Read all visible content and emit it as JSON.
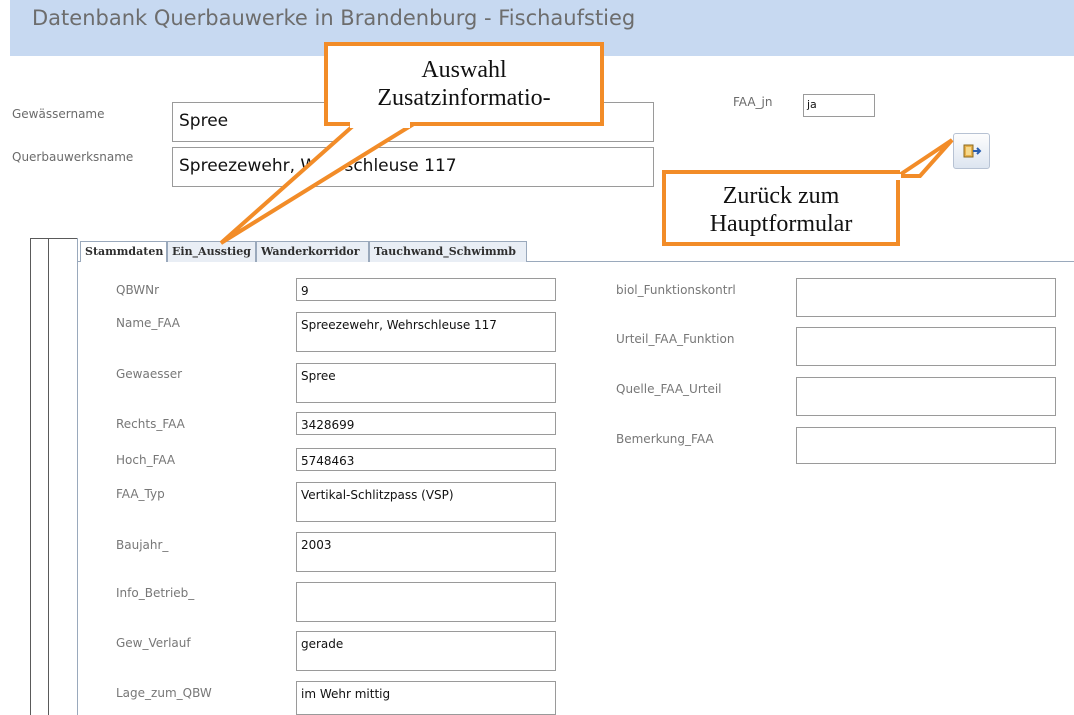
{
  "header": {
    "title": "Datenbank Querbauwerke in Brandenburg - Fischaufstieg"
  },
  "top_form": {
    "gewaessername_label": "Gewässername",
    "gewaessername_value": "Spree",
    "querbauwerksname_label": "Querbauwerksname",
    "querbauwerksname_value": "Spreezewehr, Wehrschleuse 117",
    "faa_jn_label": "FAA_jn",
    "faa_jn_value": "ja",
    "back_button_icon": "exit-form-icon"
  },
  "tabs": [
    {
      "label": "Stammdaten"
    },
    {
      "label": "Ein_Ausstieg"
    },
    {
      "label": "Wanderkorridor"
    },
    {
      "label": "Tauchwand_Schwimmb"
    }
  ],
  "left_fields": [
    {
      "label": "QBWNr",
      "value": "9"
    },
    {
      "label": "Name_FAA",
      "value": "Spreezewehr, Wehrschleuse 117"
    },
    {
      "label": "Gewaesser",
      "value": "Spree"
    },
    {
      "label": "Rechts_FAA",
      "value": "3428699"
    },
    {
      "label": "Hoch_FAA",
      "value": "5748463"
    },
    {
      "label": "FAA_Typ",
      "value": "Vertikal-Schlitzpass (VSP)"
    },
    {
      "label": "Baujahr_",
      "value": "2003"
    },
    {
      "label": "Info_Betrieb_",
      "value": ""
    },
    {
      "label": "Gew_Verlauf",
      "value": "gerade"
    },
    {
      "label": "Lage_zum_QBW",
      "value": "im Wehr mittig"
    }
  ],
  "right_fields": [
    {
      "label": "biol_Funktionskontrl",
      "value": ""
    },
    {
      "label": "Urteil_FAA_Funktion",
      "value": ""
    },
    {
      "label": "Quelle_FAA_Urteil",
      "value": ""
    },
    {
      "label": "Bemerkung_FAA",
      "value": ""
    }
  ],
  "callouts": {
    "auswahl_line1": "Auswahl",
    "auswahl_line2": "Zusatzinformatio-",
    "zurueck_line1": "Zurück zum",
    "zurueck_line2": "Hauptformular",
    "border_color": "#f28c28"
  }
}
